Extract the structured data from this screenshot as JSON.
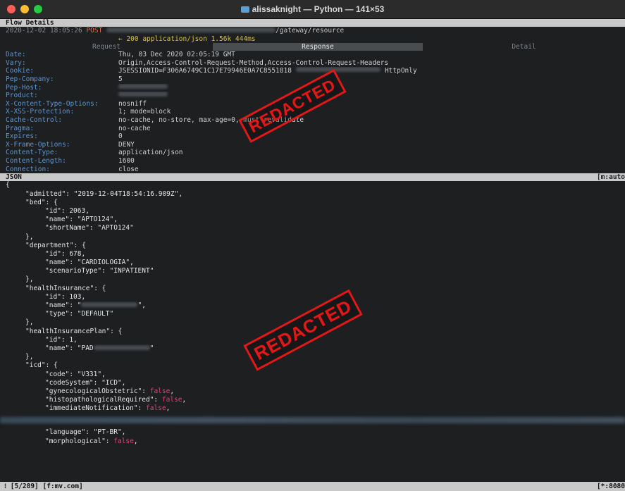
{
  "window": {
    "title": "alissaknight — Python — 141×53"
  },
  "flow": {
    "header": "Flow Details",
    "timestamp": "2020-12-02 18:05:26",
    "method": "POST",
    "path": "/gateway/resource",
    "response_line": "← 200 application/json",
    "size": "1.56k",
    "duration": "444ms"
  },
  "tabs": [
    "Request",
    "Response",
    "Detail"
  ],
  "headers": [
    {
      "k": "Date:",
      "v": "Thu, 03 Dec 2020 02:05:19 GMT"
    },
    {
      "k": "Vary:",
      "v": "Origin,Access-Control-Request-Method,Access-Control-Request-Headers"
    },
    {
      "k": "Cookie:",
      "v": "JSESSIONID=F306A6749C1C17E79946E0A7C8551818",
      "tail": "HttpOnly"
    },
    {
      "k": "Pep-Company:",
      "v": "5"
    },
    {
      "k": "Pep-Host:",
      "v": ""
    },
    {
      "k": "Product:",
      "v": ""
    },
    {
      "k": "X-Content-Type-Options:",
      "v": "nosniff"
    },
    {
      "k": "X-XSS-Protection:",
      "v": "1; mode=block"
    },
    {
      "k": "Cache-Control:",
      "v": "no-cache, no-store, max-age=0, must-revalidate"
    },
    {
      "k": "Pragma:",
      "v": "no-cache"
    },
    {
      "k": "Expires:",
      "v": "0"
    },
    {
      "k": "X-Frame-Options:",
      "v": "DENY"
    },
    {
      "k": "Content-Type:",
      "v": "application/json"
    },
    {
      "k": "Content-Length:",
      "v": "1600"
    },
    {
      "k": "Connection:",
      "v": "close"
    }
  ],
  "json_bar": {
    "label": "JSON",
    "mode": "[m:auto"
  },
  "json_lines": [
    {
      "i": 0,
      "t": "{"
    },
    {
      "i": 1,
      "t": "\"admitted\": \"2019-12-04T18:54:16.909Z\","
    },
    {
      "i": 1,
      "t": "\"bed\": {"
    },
    {
      "i": 2,
      "t": "\"id\": 2063,"
    },
    {
      "i": 2,
      "t": "\"name\": \"APTO124\","
    },
    {
      "i": 2,
      "t": "\"shortName\": \"APTO124\""
    },
    {
      "i": 1,
      "t": "},"
    },
    {
      "i": 1,
      "t": "\"department\": {"
    },
    {
      "i": 2,
      "t": "\"id\": 678,"
    },
    {
      "i": 2,
      "t": "\"name\": \"CARDIOLOGIA\","
    },
    {
      "i": 2,
      "t": "\"scenarioType\": \"INPATIENT\""
    },
    {
      "i": 1,
      "t": "},"
    },
    {
      "i": 1,
      "t": "\"healthInsurance\": {"
    },
    {
      "i": 2,
      "t": "\"id\": 103,"
    },
    {
      "i": 2,
      "t": "\"name\": \"",
      "blur": true,
      "after": "\","
    },
    {
      "i": 2,
      "t": "\"type\": \"DEFAULT\""
    },
    {
      "i": 1,
      "t": "},"
    },
    {
      "i": 1,
      "t": "\"healthInsurancePlan\": {"
    },
    {
      "i": 2,
      "t": "\"id\": 1,"
    },
    {
      "i": 2,
      "t": "\"name\": \"PAD",
      "blur": true,
      "after": "\""
    },
    {
      "i": 1,
      "t": "},"
    },
    {
      "i": 1,
      "t": "\"icd\": {"
    },
    {
      "i": 2,
      "t": "\"code\": \"V331\","
    },
    {
      "i": 2,
      "t": "\"codeSystem\": \"ICD\","
    },
    {
      "i": 2,
      "t": "\"gynecologicalObstetric\": ",
      "val": "false",
      "after": ","
    },
    {
      "i": 2,
      "t": "\"histopathologicalRequired\": ",
      "val": "false",
      "after": ","
    },
    {
      "i": 2,
      "t": "\"immediateNotification\": ",
      "val": "false",
      "after": ","
    },
    {
      "i": 0,
      "t": "",
      "blurline": true
    },
    {
      "i": 2,
      "t": "\"language\": \"PT-BR\","
    },
    {
      "i": 2,
      "t": "\"morphological\": ",
      "val": "false",
      "after": ","
    }
  ],
  "status": {
    "left": "⁝ [5/289] [f:mv.com]",
    "right": "[*:8080"
  },
  "stamps": [
    "REDACTED",
    "REDACTED"
  ]
}
